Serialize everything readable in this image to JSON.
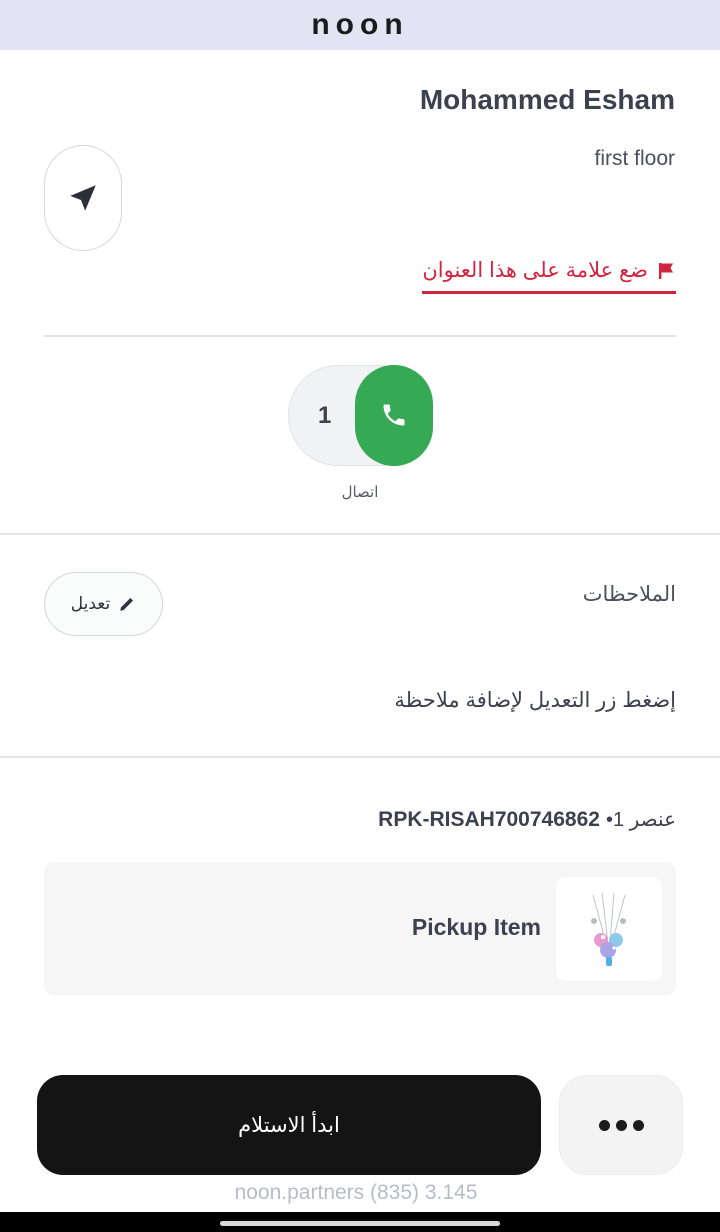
{
  "header": {
    "brand": "noon"
  },
  "customer": {
    "name": "Mohammed Esham",
    "address_line": "first floor"
  },
  "actions": {
    "flag_address_label": "ضع علامة على هذا العنوان"
  },
  "call": {
    "count": "1",
    "label": "اتصال"
  },
  "notes": {
    "title": "الملاحظات",
    "edit_label": "تعديل",
    "hint": "إضغط زر التعديل لإضافة ملاحظة"
  },
  "item": {
    "count_prefix": "عنصر 1•",
    "sku": "RPK-RISAH700746862",
    "name": "Pickup Item"
  },
  "footer": {
    "start_label": "ابدأ الاستلام",
    "watermark": "noon.partners (835) 3.145"
  },
  "colors": {
    "accent_red": "#d3243f",
    "call_green": "#36a955",
    "primary_button": "#141414"
  },
  "icons": {
    "navigate": "navigation-arrow-icon",
    "flag": "flag-icon",
    "phone": "phone-icon",
    "edit": "pencil-icon",
    "more": "more-dots-icon"
  }
}
